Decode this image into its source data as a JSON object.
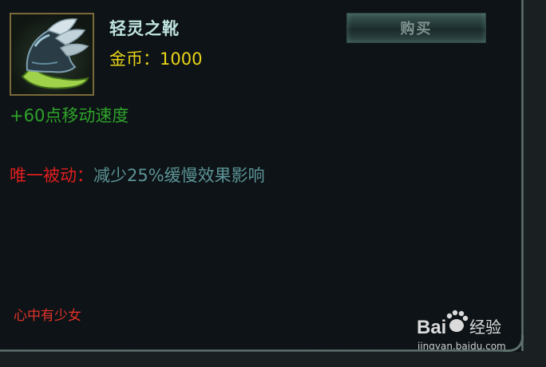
{
  "item": {
    "name": "轻灵之靴",
    "price_label": "金币：",
    "price_value": "1000",
    "icon": "boots-icon"
  },
  "buy_button": {
    "label": "购买"
  },
  "stats": {
    "line": "+60点移动速度"
  },
  "passive": {
    "label": "唯一被动：",
    "text": "减少25%缓慢效果影响"
  },
  "watermark": {
    "author": "心中有少女",
    "site_brand": "Bai经验",
    "site_url": "jingyan.baidu.com"
  },
  "colors": {
    "name": "#bfe3e0",
    "price": "#e9d41a",
    "stat": "#2fa32a",
    "passive_label": "#e01e1e",
    "passive_text": "#5c9496",
    "background": "#0d1316"
  }
}
